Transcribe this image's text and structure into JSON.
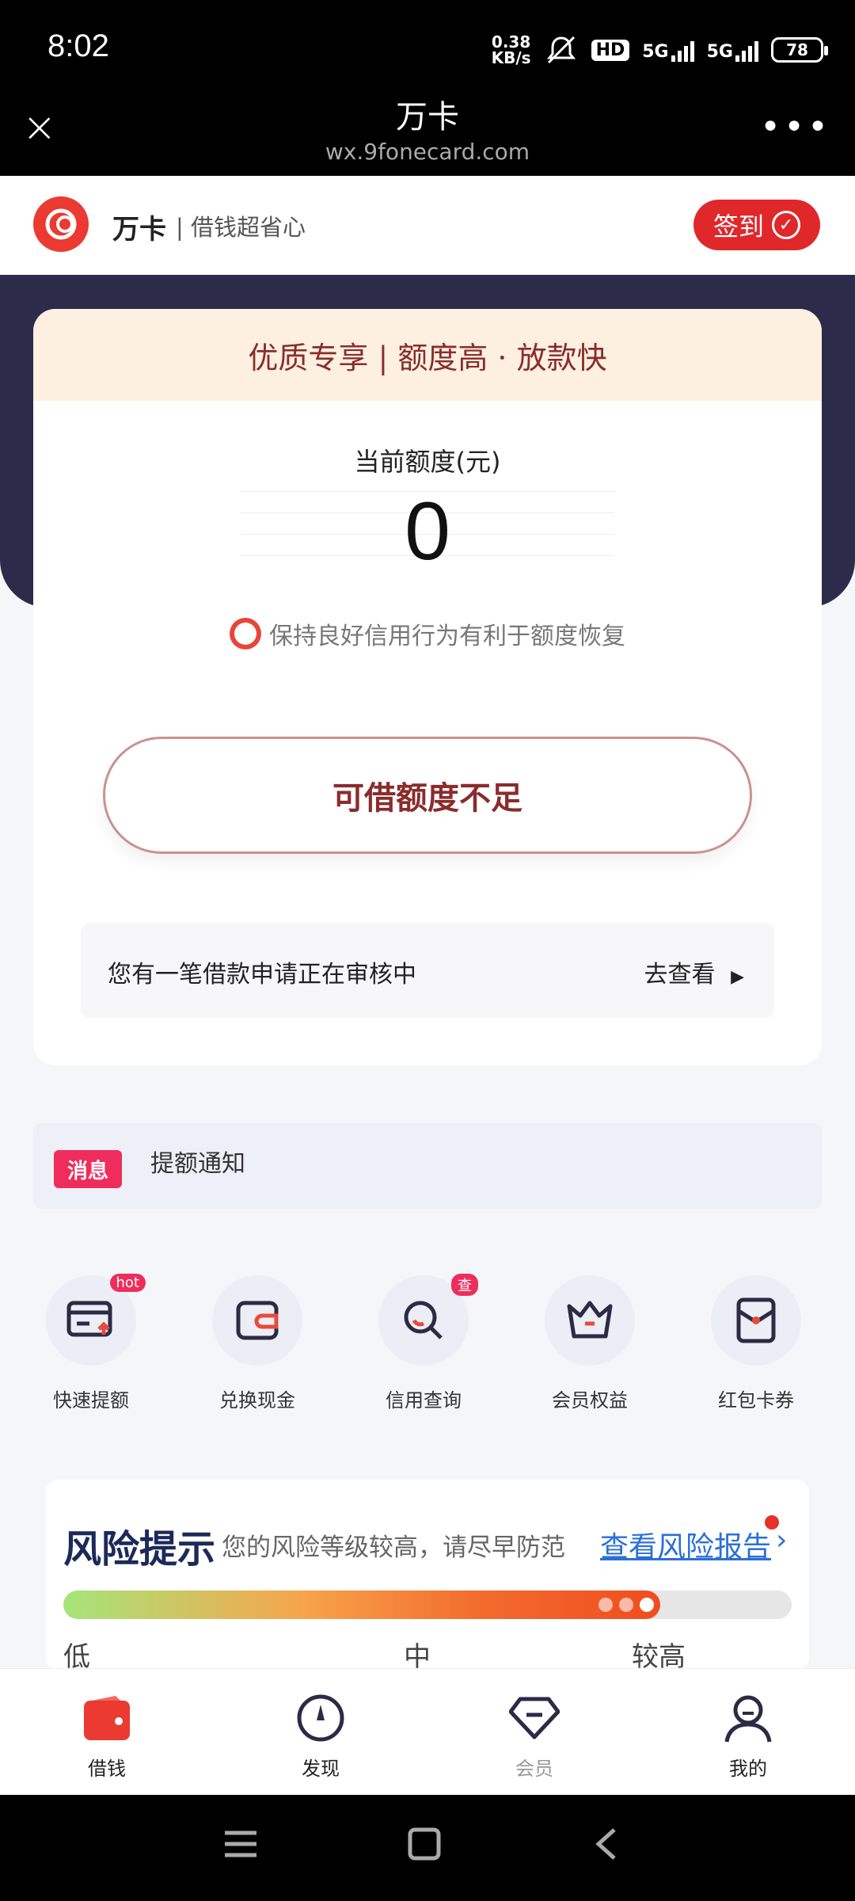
{
  "status_bar": {
    "time": "8:02",
    "net_speed_value": "0.38",
    "net_speed_unit": "KB/s",
    "hd_label": "HD",
    "signal1": "5G",
    "signal2": "5G",
    "battery": "78"
  },
  "browser": {
    "close_icon": "×",
    "title": "万卡",
    "url": "wx.9fonecard.com",
    "more_icon": "•••"
  },
  "header": {
    "brand": "万卡",
    "slogan": "| 借钱超省心",
    "signin_label": "签到",
    "signin_check": "✓"
  },
  "card": {
    "banner": "优质专享 | 额度高 · 放款快",
    "quota_label": "当前额度(元)",
    "quota_value": "0",
    "tip": "保持良好信用行为有利于额度恢复",
    "cta_label": "可借额度不足",
    "review_text": "您有一笔借款申请正在审核中",
    "review_link": "去查看",
    "review_arrow": "▶"
  },
  "message": {
    "badge": "消息",
    "text": "提额通知"
  },
  "shortcuts": [
    {
      "label": "快速提额",
      "tag": "hot"
    },
    {
      "label": "兑换现金",
      "tag": ""
    },
    {
      "label": "信用查询",
      "tag": "查"
    },
    {
      "label": "会员权益",
      "tag": ""
    },
    {
      "label": "红包卡券",
      "tag": ""
    }
  ],
  "risk": {
    "title": "风险提示",
    "subtitle": "您的风险等级较高，请尽早防范",
    "link": "查看风险报告",
    "arrow": "›",
    "level_fraction": 0.82,
    "levels": [
      "低",
      "中",
      "较高"
    ]
  },
  "tabs": [
    {
      "label": "借钱",
      "icon": "wallet-icon",
      "active": true
    },
    {
      "label": "发现",
      "icon": "compass-icon",
      "active": false
    },
    {
      "label": "会员",
      "icon": "diamond-icon",
      "active": false
    },
    {
      "label": "我的",
      "icon": "person-icon",
      "active": false
    }
  ],
  "colors": {
    "accent": "#e0282b",
    "hero_bg": "#2d2b4a",
    "cta_text": "#8a2c2c"
  }
}
